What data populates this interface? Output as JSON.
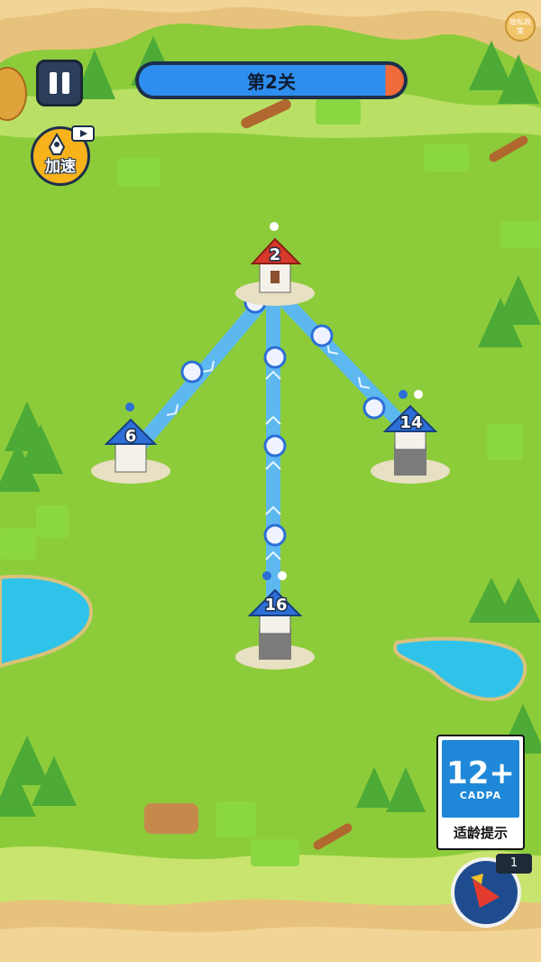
{
  "hud": {
    "level_title": "第2关",
    "speed_label": "加速",
    "privacy_label": "隐私政策",
    "skill_count": "1"
  },
  "age_rating": {
    "age": "12+",
    "org": "CADPA",
    "tip": "适龄提示"
  },
  "towers": [
    {
      "id": "enemy-top",
      "count": "2",
      "owner": "red"
    },
    {
      "id": "player-left",
      "count": "6",
      "owner": "blue"
    },
    {
      "id": "player-right",
      "count": "14",
      "owner": "blue"
    },
    {
      "id": "player-bottom",
      "count": "16",
      "owner": "blue"
    }
  ],
  "colors": {
    "grass": "#8ccc3a",
    "player": "#2d6fd6",
    "enemy": "#d8392b",
    "path": "#5db8f0",
    "water": "#2fc3ea"
  }
}
